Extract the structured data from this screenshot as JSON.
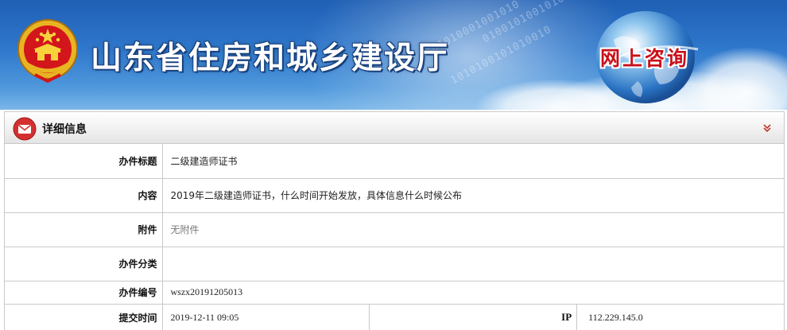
{
  "banner": {
    "site_title": "山东省住房和城乡建设厅",
    "section_tag": "网上咨询",
    "binary_text_1": "0101010001001010",
    "binary_text_2": "1010100101010010",
    "binary_text_3": "0100101001010100",
    "colors": {
      "sky": "#2f78cc",
      "title_outline": "#17407e",
      "tag_red": "#c8101a"
    },
    "icons": [
      "national-emblem-icon",
      "globe-icon"
    ]
  },
  "panel": {
    "title": "详细信息",
    "icons": [
      "mail-icon",
      "double-chevron-down-icon"
    ],
    "accent_color": "#d43030"
  },
  "details": {
    "title_label": "办件标题",
    "title_value": "二级建造师证书",
    "content_label": "内容",
    "content_value": "2019年二级建造师证书，什么时间开始发放，具体信息什么时候公布",
    "attachment_label": "附件",
    "attachment_value": "无附件",
    "category_label": "办件分类",
    "category_value": "",
    "number_label": "办件编号",
    "number_value": "wszx20191205013",
    "submit_time_label": "提交时间",
    "submit_time_value": "2019-12-11 09:05",
    "ip_label": "IP",
    "ip_value": "112.229.145.0"
  }
}
